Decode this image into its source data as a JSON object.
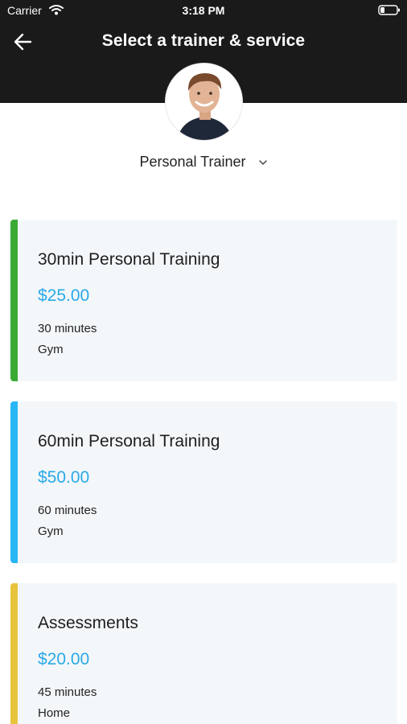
{
  "status_bar": {
    "carrier": "Carrier",
    "time": "3:18 PM"
  },
  "header": {
    "title": "Select a trainer & service",
    "back_icon": "arrow-left-icon"
  },
  "trainer": {
    "selected": "Personal Trainer",
    "dropdown_icon": "chevron-down-icon"
  },
  "services": [
    {
      "name": "30min Personal Training",
      "price": "$25.00",
      "duration": "30 minutes",
      "location": "Gym",
      "accent": "#3aaa35"
    },
    {
      "name": "60min Personal Training",
      "price": "$50.00",
      "duration": "60 minutes",
      "location": "Gym",
      "accent": "#29b6f6"
    },
    {
      "name": "Assessments",
      "price": "$20.00",
      "duration": "45 minutes",
      "location": "Home",
      "accent": "#e8c33c"
    }
  ],
  "colors": {
    "header_bg": "#1b1a1a",
    "price": "#2aa9e8",
    "card_bg": "#f3f7fa"
  }
}
